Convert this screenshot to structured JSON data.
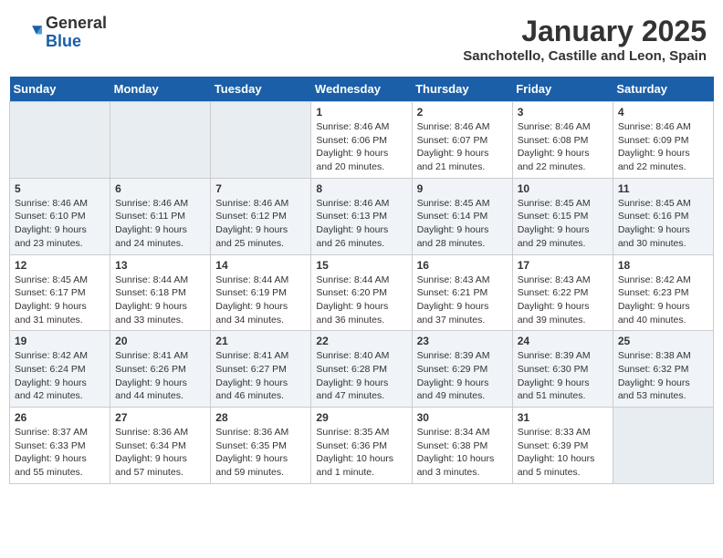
{
  "header": {
    "logo_general": "General",
    "logo_blue": "Blue",
    "month": "January 2025",
    "location": "Sanchotello, Castille and Leon, Spain"
  },
  "weekdays": [
    "Sunday",
    "Monday",
    "Tuesday",
    "Wednesday",
    "Thursday",
    "Friday",
    "Saturday"
  ],
  "weeks": [
    [
      {
        "day": "",
        "info": ""
      },
      {
        "day": "",
        "info": ""
      },
      {
        "day": "",
        "info": ""
      },
      {
        "day": "1",
        "info": "Sunrise: 8:46 AM\nSunset: 6:06 PM\nDaylight: 9 hours\nand 20 minutes."
      },
      {
        "day": "2",
        "info": "Sunrise: 8:46 AM\nSunset: 6:07 PM\nDaylight: 9 hours\nand 21 minutes."
      },
      {
        "day": "3",
        "info": "Sunrise: 8:46 AM\nSunset: 6:08 PM\nDaylight: 9 hours\nand 22 minutes."
      },
      {
        "day": "4",
        "info": "Sunrise: 8:46 AM\nSunset: 6:09 PM\nDaylight: 9 hours\nand 22 minutes."
      }
    ],
    [
      {
        "day": "5",
        "info": "Sunrise: 8:46 AM\nSunset: 6:10 PM\nDaylight: 9 hours\nand 23 minutes."
      },
      {
        "day": "6",
        "info": "Sunrise: 8:46 AM\nSunset: 6:11 PM\nDaylight: 9 hours\nand 24 minutes."
      },
      {
        "day": "7",
        "info": "Sunrise: 8:46 AM\nSunset: 6:12 PM\nDaylight: 9 hours\nand 25 minutes."
      },
      {
        "day": "8",
        "info": "Sunrise: 8:46 AM\nSunset: 6:13 PM\nDaylight: 9 hours\nand 26 minutes."
      },
      {
        "day": "9",
        "info": "Sunrise: 8:45 AM\nSunset: 6:14 PM\nDaylight: 9 hours\nand 28 minutes."
      },
      {
        "day": "10",
        "info": "Sunrise: 8:45 AM\nSunset: 6:15 PM\nDaylight: 9 hours\nand 29 minutes."
      },
      {
        "day": "11",
        "info": "Sunrise: 8:45 AM\nSunset: 6:16 PM\nDaylight: 9 hours\nand 30 minutes."
      }
    ],
    [
      {
        "day": "12",
        "info": "Sunrise: 8:45 AM\nSunset: 6:17 PM\nDaylight: 9 hours\nand 31 minutes."
      },
      {
        "day": "13",
        "info": "Sunrise: 8:44 AM\nSunset: 6:18 PM\nDaylight: 9 hours\nand 33 minutes."
      },
      {
        "day": "14",
        "info": "Sunrise: 8:44 AM\nSunset: 6:19 PM\nDaylight: 9 hours\nand 34 minutes."
      },
      {
        "day": "15",
        "info": "Sunrise: 8:44 AM\nSunset: 6:20 PM\nDaylight: 9 hours\nand 36 minutes."
      },
      {
        "day": "16",
        "info": "Sunrise: 8:43 AM\nSunset: 6:21 PM\nDaylight: 9 hours\nand 37 minutes."
      },
      {
        "day": "17",
        "info": "Sunrise: 8:43 AM\nSunset: 6:22 PM\nDaylight: 9 hours\nand 39 minutes."
      },
      {
        "day": "18",
        "info": "Sunrise: 8:42 AM\nSunset: 6:23 PM\nDaylight: 9 hours\nand 40 minutes."
      }
    ],
    [
      {
        "day": "19",
        "info": "Sunrise: 8:42 AM\nSunset: 6:24 PM\nDaylight: 9 hours\nand 42 minutes."
      },
      {
        "day": "20",
        "info": "Sunrise: 8:41 AM\nSunset: 6:26 PM\nDaylight: 9 hours\nand 44 minutes."
      },
      {
        "day": "21",
        "info": "Sunrise: 8:41 AM\nSunset: 6:27 PM\nDaylight: 9 hours\nand 46 minutes."
      },
      {
        "day": "22",
        "info": "Sunrise: 8:40 AM\nSunset: 6:28 PM\nDaylight: 9 hours\nand 47 minutes."
      },
      {
        "day": "23",
        "info": "Sunrise: 8:39 AM\nSunset: 6:29 PM\nDaylight: 9 hours\nand 49 minutes."
      },
      {
        "day": "24",
        "info": "Sunrise: 8:39 AM\nSunset: 6:30 PM\nDaylight: 9 hours\nand 51 minutes."
      },
      {
        "day": "25",
        "info": "Sunrise: 8:38 AM\nSunset: 6:32 PM\nDaylight: 9 hours\nand 53 minutes."
      }
    ],
    [
      {
        "day": "26",
        "info": "Sunrise: 8:37 AM\nSunset: 6:33 PM\nDaylight: 9 hours\nand 55 minutes."
      },
      {
        "day": "27",
        "info": "Sunrise: 8:36 AM\nSunset: 6:34 PM\nDaylight: 9 hours\nand 57 minutes."
      },
      {
        "day": "28",
        "info": "Sunrise: 8:36 AM\nSunset: 6:35 PM\nDaylight: 9 hours\nand 59 minutes."
      },
      {
        "day": "29",
        "info": "Sunrise: 8:35 AM\nSunset: 6:36 PM\nDaylight: 10 hours\nand 1 minute."
      },
      {
        "day": "30",
        "info": "Sunrise: 8:34 AM\nSunset: 6:38 PM\nDaylight: 10 hours\nand 3 minutes."
      },
      {
        "day": "31",
        "info": "Sunrise: 8:33 AM\nSunset: 6:39 PM\nDaylight: 10 hours\nand 5 minutes."
      },
      {
        "day": "",
        "info": ""
      }
    ]
  ]
}
